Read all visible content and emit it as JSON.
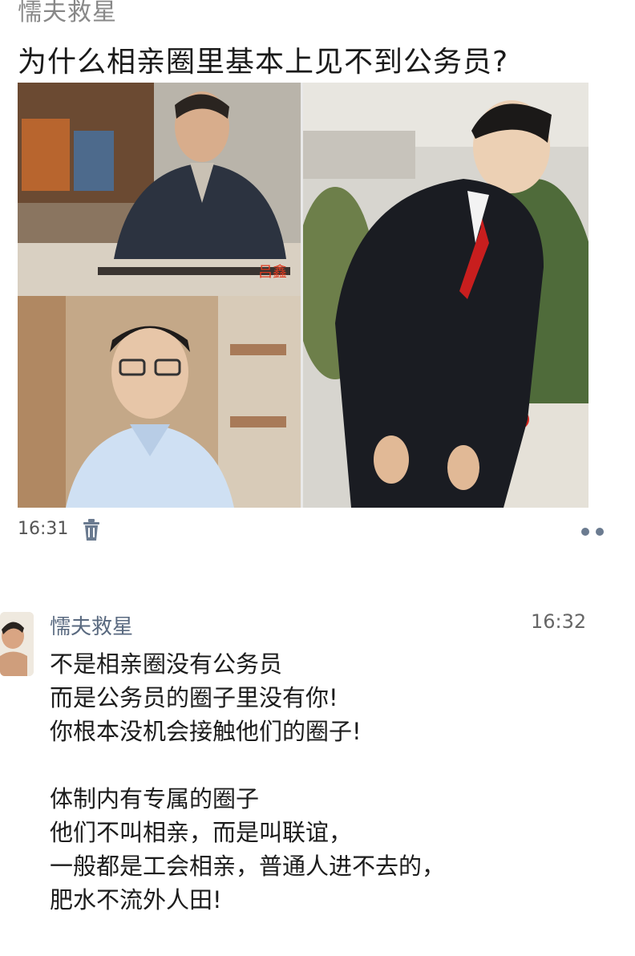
{
  "post": {
    "author": "懦夫救星",
    "title": "为什么相亲圈里基本上见不到公务员?",
    "time": "16:31",
    "photo_caption": "吕鑫"
  },
  "comment": {
    "author": "懦夫救星",
    "time": "16:32",
    "paragraph1": [
      "不是相亲圈没有公务员",
      "而是公务员的圈子里没有你!",
      "你根本没机会接触他们的圈子!"
    ],
    "paragraph2": [
      "体制内有专属的圈子",
      "他们不叫相亲，而是叫联谊，",
      "一般都是工会相亲，普通人进不去的，",
      "肥水不流外人田!"
    ]
  },
  "icons": {
    "delete": "trash-icon",
    "more": "more-dots-icon"
  },
  "colors": {
    "comment_author": "#5a6a80",
    "caption": "#e03a1e",
    "tie": "#c81e1e"
  }
}
